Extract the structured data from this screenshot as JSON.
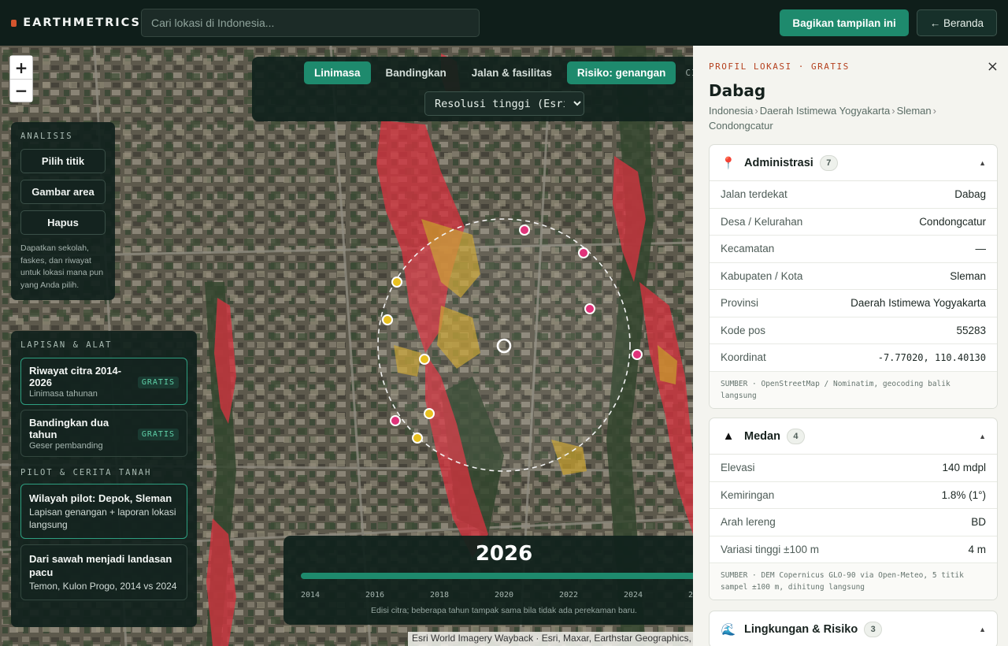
{
  "app": {
    "brand": "EARTHMETRICS",
    "search_placeholder": "Cari lokasi di Indonesia...",
    "share_label": "Bagikan tampilan ini",
    "home_label": "← Beranda"
  },
  "map": {
    "zoom_in": "+",
    "zoom_out": "−",
    "tabs": [
      {
        "label": "Linimasa",
        "active": true
      },
      {
        "label": "Bandingkan",
        "active": false
      },
      {
        "label": "Jalan & fasilitas",
        "active": false
      },
      {
        "label": "Risiko: genangan",
        "active": true
      },
      {
        "label": "CIT",
        "active": false
      }
    ],
    "imagery_select": "Resolusi tinggi (Esri)",
    "attribution": "Esri World Imagery Wayback · Esri, Maxar, Earthstar Geographics,"
  },
  "analysis": {
    "label": "ANALISIS",
    "buttons": [
      "Pilih titik",
      "Gambar area",
      "Hapus"
    ],
    "hint": "Dapatkan sekolah, faskes, dan riwayat untuk lokasi mana pun yang Anda pilih."
  },
  "layers": {
    "label": "LAPISAN & ALAT",
    "items": [
      {
        "title": "Riwayat citra 2014-2026",
        "sub": "Linimasa tahunan",
        "badge": "GRATIS"
      },
      {
        "title": "Bandingkan dua tahun",
        "sub": "Geser pembanding",
        "badge": "GRATIS"
      }
    ],
    "pilot_label": "PILOT & CERITA TANAH",
    "pilots": [
      {
        "title": "Wilayah pilot: Depok, Sleman",
        "sub": "Lapisan genangan + laporan lokasi langsung"
      },
      {
        "title": "Dari sawah menjadi landasan pacu",
        "sub": "Temon, Kulon Progo, 2014 vs 2024"
      }
    ]
  },
  "timeline": {
    "year": "2026",
    "ticks": [
      "2014",
      "2016",
      "2018",
      "2020",
      "2022",
      "2024",
      "2"
    ],
    "caption": "Edisi citra; beberapa tahun tampak sama bila tidak ada perekaman baru."
  },
  "panel": {
    "eyebrow": "PROFIL LOKASI · GRATIS",
    "close": "×",
    "place": "Dabag",
    "crumbs": [
      "Indonesia",
      "Daerah Istimewa Yogyakarta",
      "Sleman",
      "Condongcatur"
    ],
    "sections": [
      {
        "icon": "📍",
        "title": "Administrasi",
        "count": "7",
        "rows": [
          {
            "k": "Jalan terdekat",
            "v": "Dabag"
          },
          {
            "k": "Desa / Kelurahan",
            "v": "Condongcatur"
          },
          {
            "k": "Kecamatan",
            "v": "—"
          },
          {
            "k": "Kabupaten / Kota",
            "v": "Sleman"
          },
          {
            "k": "Provinsi",
            "v": "Daerah Istimewa Yogyakarta"
          },
          {
            "k": "Kode pos",
            "v": "55283"
          },
          {
            "k": "Koordinat",
            "v": "-7.77020, 110.40130"
          }
        ],
        "source": "SUMBER · OpenStreetMap / Nominatim, geocoding balik langsung"
      },
      {
        "icon": "▲",
        "title": "Medan",
        "count": "4",
        "rows": [
          {
            "k": "Elevasi",
            "v": "140 mdpl"
          },
          {
            "k": "Kemiringan",
            "v": "1.8% (1°)"
          },
          {
            "k": "Arah lereng",
            "v": "BD"
          },
          {
            "k": "Variasi tinggi ±100 m",
            "v": "4 m"
          }
        ],
        "source": "SUMBER · DEM Copernicus GLO-90 via Open-Meteo, 5 titik sampel ±100 m, dihitung langsung"
      },
      {
        "icon": "🌊",
        "title": "Lingkungan & Risiko",
        "count": "3"
      }
    ]
  },
  "colors": {
    "accent": "#1e8a6d",
    "flood": "#d3333f",
    "flood_moderate": "#c9a12c",
    "poi_school": "#e0327a",
    "poi_health": "#e8c020"
  }
}
